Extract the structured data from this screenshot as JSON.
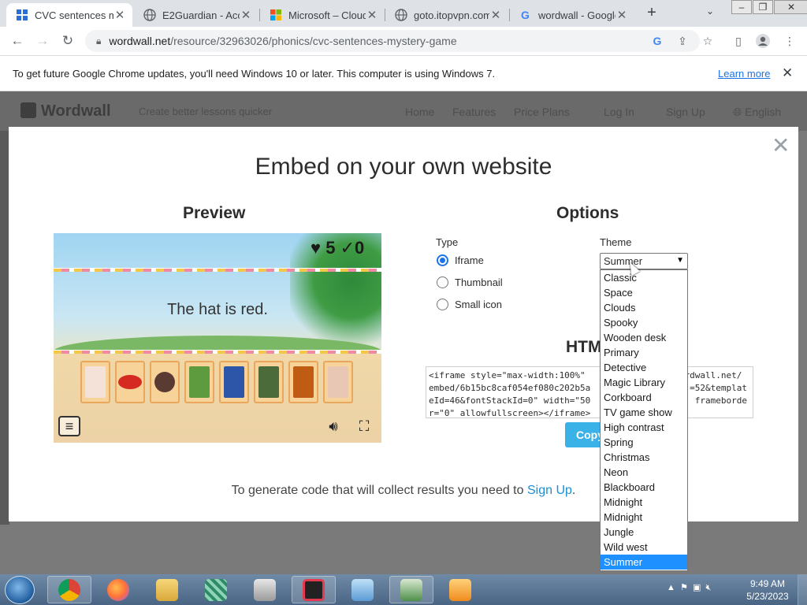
{
  "browser": {
    "tabs": [
      {
        "title": "CVC sentences my",
        "favicon": "wordwall-icon",
        "active": true
      },
      {
        "title": "E2Guardian - Acc",
        "favicon": "globe-icon",
        "active": false
      },
      {
        "title": "Microsoft – Cloud",
        "favicon": "microsoft-icon",
        "active": false
      },
      {
        "title": "goto.itopvpn.com",
        "favicon": "globe-icon",
        "active": false
      },
      {
        "title": "wordwall - Google",
        "favicon": "google-icon",
        "active": false
      }
    ],
    "new_tab": "+",
    "url_host": "wordwall.net",
    "url_path": "/resource/32963026/phonics/cvc-sentences-mystery-game"
  },
  "infobar": {
    "message": "To get future Google Chrome updates, you'll need Windows 10 or later. This computer is using Windows 7.",
    "link": "Learn more"
  },
  "site": {
    "logo": "Wordwall",
    "tagline": "Create better lessons quicker",
    "nav": [
      "Home",
      "Features",
      "Price Plans",
      "Log In",
      "Sign Up",
      "English"
    ]
  },
  "modal": {
    "title": "Embed on your own website",
    "preview_heading": "Preview",
    "options_heading": "Options",
    "preview": {
      "lives": "5",
      "correct": "0",
      "sentence": "The hat is red."
    },
    "type_label": "Type",
    "type_options": [
      {
        "label": "Iframe",
        "checked": true
      },
      {
        "label": "Thumbnail",
        "checked": false
      },
      {
        "label": "Small icon",
        "checked": false
      }
    ],
    "theme_label": "Theme",
    "theme_selected": "Summer",
    "html_heading": "HTM",
    "code": "<iframe style=\"max-width:100%\"                   rdwall.net/\nembed/6b15bc8caf054ef080c202b5a                   =52&templat\neId=46&fontStackId=0\" width=\"50                    frameborde\nr=\"0\" allowfullscreen></iframe>",
    "copy_label": "Copy",
    "footer_text": "To generate code that will collect results you need to ",
    "footer_link": "Sign Up",
    "footer_end": "."
  },
  "theme_list": [
    "Classic",
    "Space",
    "Clouds",
    "Spooky",
    "Wooden desk",
    "Primary",
    "Detective",
    "Magic Library",
    "Corkboard",
    "TV game show",
    "High contrast",
    "Spring",
    "Christmas",
    "Neon",
    "Blackboard",
    "Midnight",
    "Midnight",
    "Jungle",
    "Wild west",
    "Summer"
  ],
  "theme_highlighted": "Summer",
  "taskbar": {
    "time": "9:49 AM",
    "date": "5/23/2023",
    "apps": [
      "chrome-icon",
      "firefox-icon",
      "file-explorer-icon",
      "network-app-icon",
      "printer-icon",
      "screen-recorder-icon",
      "control-panel-icon",
      "remote-desktop-icon",
      "media-player-icon"
    ]
  }
}
